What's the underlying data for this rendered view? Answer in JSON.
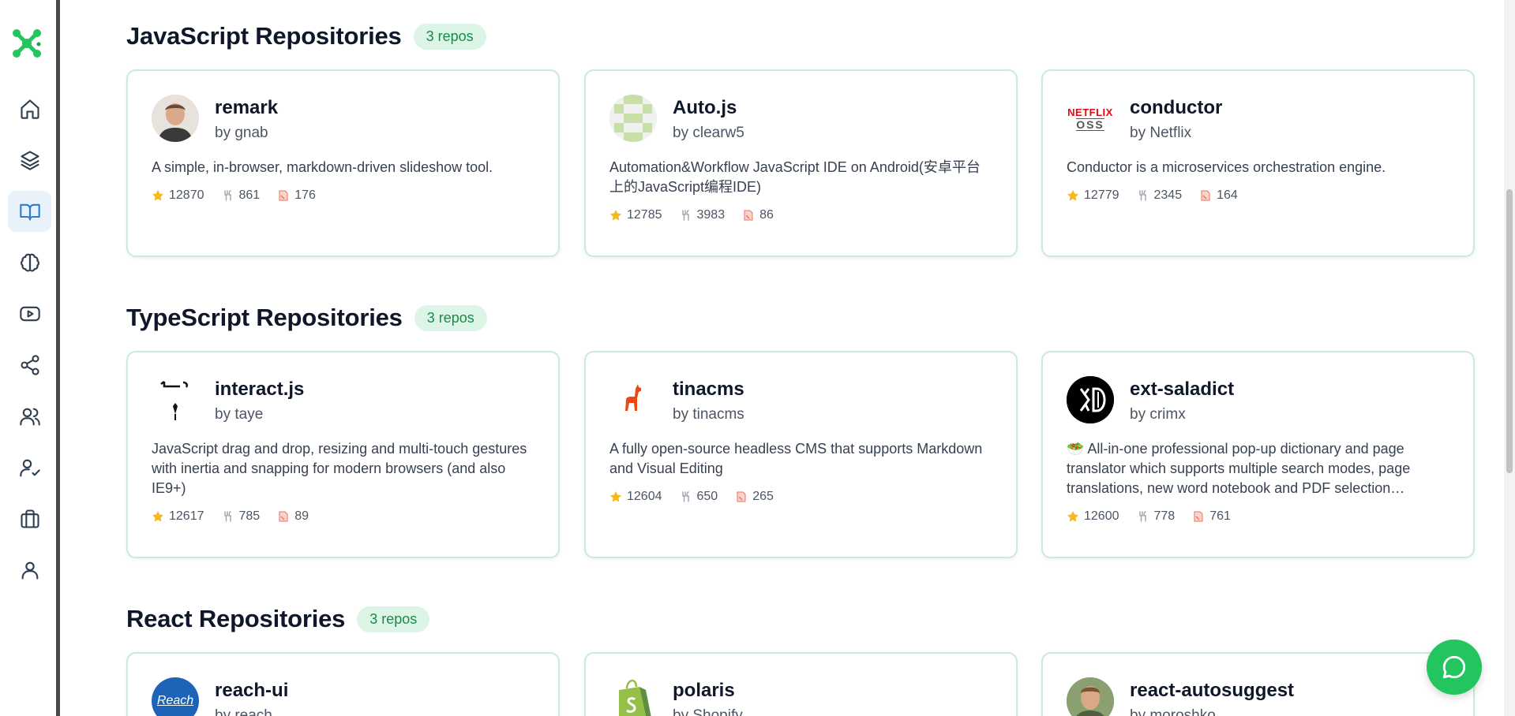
{
  "sections": [
    {
      "title": "JavaScript Repositories",
      "badge": "3 repos",
      "repos": [
        {
          "name": "remark",
          "owner": "by gnab",
          "description": "A simple, in-browser, markdown-driven slideshow tool.",
          "stars": "12870",
          "forks": "861",
          "issues": "176"
        },
        {
          "name": "Auto.js",
          "owner": "by clearw5",
          "description": "Automation&Workflow JavaScript IDE on Android(安卓平台上的JavaScript编程IDE)",
          "stars": "12785",
          "forks": "3983",
          "issues": "86"
        },
        {
          "name": "conductor",
          "owner": "by Netflix",
          "description": "Conductor is a microservices orchestration engine.",
          "stars": "12779",
          "forks": "2345",
          "issues": "164",
          "logo_text": [
            "NETFLIX",
            "OSS"
          ]
        }
      ]
    },
    {
      "title": "TypeScript Repositories",
      "badge": "3 repos",
      "repos": [
        {
          "name": "interact.js",
          "owner": "by taye",
          "description": "JavaScript drag and drop, resizing and multi-touch gestures with inertia and snapping for modern browsers (and also IE9+)",
          "stars": "12617",
          "forks": "785",
          "issues": "89"
        },
        {
          "name": "tinacms",
          "owner": "by tinacms",
          "description": "A fully open-source headless CMS that supports Markdown and Visual Editing",
          "stars": "12604",
          "forks": "650",
          "issues": "265"
        },
        {
          "name": "ext-saladict",
          "owner": "by crimx",
          "description": "🥗 All-in-one professional pop-up dictionary and page translator which supports multiple search modes, page translations, new word notebook and PDF selection…",
          "stars": "12600",
          "forks": "778",
          "issues": "761"
        }
      ]
    },
    {
      "title": "React Repositories",
      "badge": "3 repos",
      "repos": [
        {
          "name": "reach-ui",
          "owner": "by reach",
          "logo_text": "Reach"
        },
        {
          "name": "polaris",
          "owner": "by Shopify"
        },
        {
          "name": "react-autosuggest",
          "owner": "by moroshko"
        }
      ]
    }
  ],
  "nav": [
    "home",
    "courses",
    "library",
    "brain",
    "videos",
    "share",
    "community",
    "mentors",
    "careers",
    "profile"
  ],
  "active_nav": "library",
  "colors": {
    "accent": "#22c55e",
    "badge_bg": "#dcf5e6",
    "badge_text": "#1a8a4a",
    "card_border": "#c9ecd6",
    "active_nav": "#2f7bd0"
  }
}
